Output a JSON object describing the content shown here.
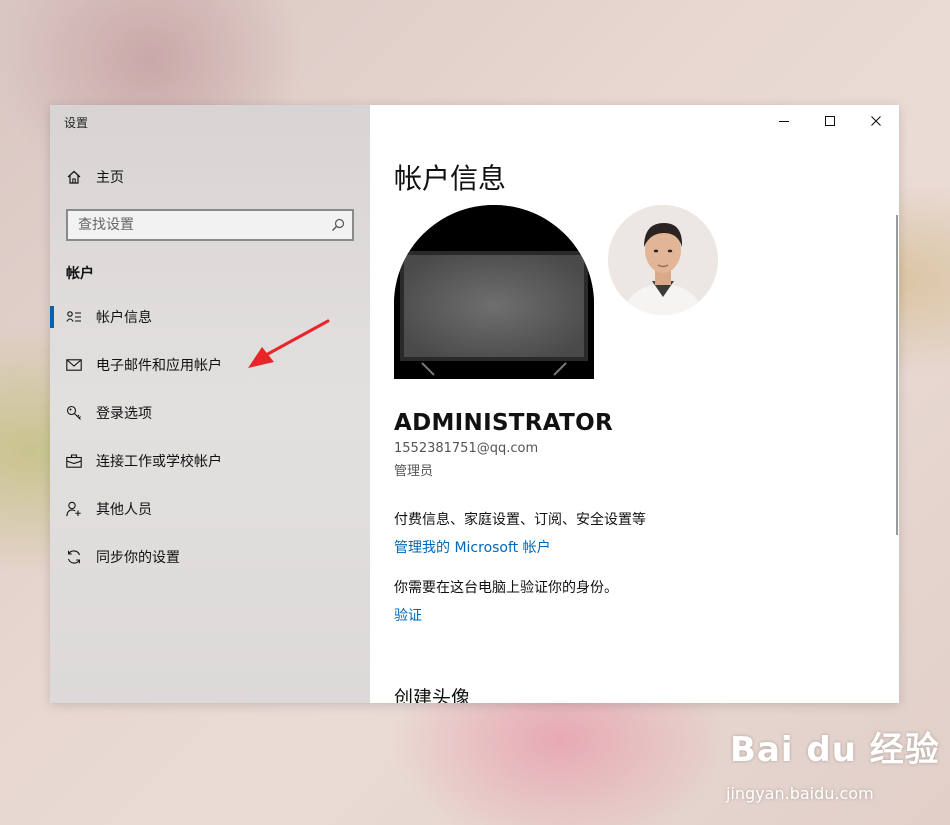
{
  "window": {
    "app_title": "设置"
  },
  "sidebar": {
    "home_label": "主页",
    "search_placeholder": "查找设置",
    "section_title": "帐户",
    "items": [
      {
        "label": "帐户信息",
        "icon": "account-info-icon",
        "active": true
      },
      {
        "label": "电子邮件和应用帐户",
        "icon": "mail-icon",
        "active": false
      },
      {
        "label": "登录选项",
        "icon": "key-icon",
        "active": false
      },
      {
        "label": "连接工作或学校帐户",
        "icon": "briefcase-icon",
        "active": false
      },
      {
        "label": "其他人员",
        "icon": "person-add-icon",
        "active": false
      },
      {
        "label": "同步你的设置",
        "icon": "sync-icon",
        "active": false
      }
    ]
  },
  "content": {
    "page_title": "帐户信息",
    "user_name": "ADMINISTRATOR",
    "user_email": "1552381751@qq.com",
    "user_role": "管理员",
    "billing_text": "付费信息、家庭设置、订阅、安全设置等",
    "manage_link": "管理我的 Microsoft 帐户",
    "verify_text": "你需要在这台电脑上验证你的身份。",
    "verify_link": "验证",
    "create_avatar_title": "创建头像"
  },
  "watermark": {
    "logo": "Bai du 经验",
    "url": "jingyan.baidu.com"
  },
  "colors": {
    "accent": "#0063b1",
    "link": "#0067b8",
    "annotation_arrow": "#e8262a"
  }
}
